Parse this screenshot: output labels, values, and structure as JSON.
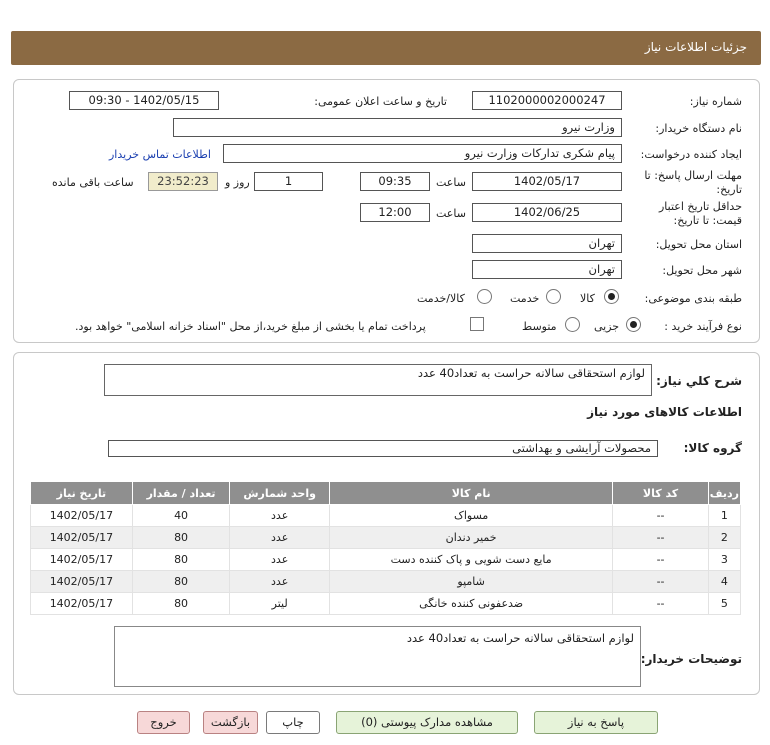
{
  "header": {
    "title": "جزئیات اطلاعات نیاز"
  },
  "form": {
    "need_number_label": "شماره نیاز:",
    "need_number": "1102000002000247",
    "announce_label": "تاریخ و ساعت اعلان عمومی:",
    "announce_value": "1402/05/15 - 09:30",
    "buyer_org_label": "نام دستگاه خریدار:",
    "buyer_org": "وزارت نیرو",
    "creator_label": "ایجاد کننده درخواست:",
    "creator": "پیام شکری تدارکات وزارت نیرو",
    "contact_link": "اطلاعات تماس خریدار",
    "deadline_label_1": "مهلت ارسال پاسخ: تا",
    "deadline_label_2": "تاریخ:",
    "deadline_date": "1402/05/17",
    "time_label": "ساعت",
    "deadline_time": "09:35",
    "days_value": "1",
    "days_label": "روز و",
    "timer": "23:52:23",
    "remaining_label": "ساعت باقی مانده",
    "validity_label_1": "حداقل تاریخ اعتبار",
    "validity_label_2": "قیمت: تا تاریخ:",
    "validity_date": "1402/06/25",
    "validity_time": "12:00",
    "province_label": "استان محل تحویل:",
    "province": "تهران",
    "city_label": "شهر محل تحویل:",
    "city": "تهران",
    "category_label": "طبقه بندی موضوعی:",
    "category_options": [
      "کالا",
      "خدمت",
      "کالا/خدمت"
    ],
    "category_selected": "کالا",
    "process_label": "نوع فرآیند خرید :",
    "process_options": [
      "جزیی",
      "متوسط"
    ],
    "process_selected": "جزیی",
    "treasury_text": "پرداخت تمام یا بخشی از مبلغ خرید،از محل \"اسناد خزانه اسلامی\" خواهد بود."
  },
  "summary": {
    "label": "شرح کلي نياز:",
    "value": "لوازم استحقاقی سالانه حراست به تعداد40 عدد"
  },
  "goods": {
    "section_title": "اطلاعات کالاهای مورد نیاز",
    "group_label": "گروه کالا:",
    "group_value": "محصولات آرایشی و بهداشتی",
    "columns": [
      "ردیف",
      "کد کالا",
      "نام کالا",
      "واحد شمارش",
      "تعداد / مقدار",
      "تاریخ نیاز"
    ],
    "rows": [
      [
        "1",
        "--",
        "مسواک",
        "عدد",
        "40",
        "1402/05/17"
      ],
      [
        "2",
        "--",
        "خمیر دندان",
        "عدد",
        "80",
        "1402/05/17"
      ],
      [
        "3",
        "--",
        "مایع دست شویی و پاک کننده دست",
        "عدد",
        "80",
        "1402/05/17"
      ],
      [
        "4",
        "--",
        "شامپو",
        "عدد",
        "80",
        "1402/05/17"
      ],
      [
        "5",
        "--",
        "ضدعفونی کننده خانگی",
        "لیتر",
        "80",
        "1402/05/17"
      ]
    ]
  },
  "buyer_notes": {
    "label": "توضیحات خریدار:",
    "value": "لوازم استحقاقی سالانه حراست به تعداد40 عدد"
  },
  "buttons": {
    "reply": "پاسخ به نیاز",
    "attachments": "مشاهده مدارک پیوستی (0)",
    "print": "چاپ",
    "back": "بازگشت",
    "exit": "خروج"
  },
  "colors": {
    "header_bg": "#8b6a43",
    "table_header_bg": "#8f8f8f",
    "timer_bg": "#f1eccb",
    "link": "#1a3fb0"
  }
}
